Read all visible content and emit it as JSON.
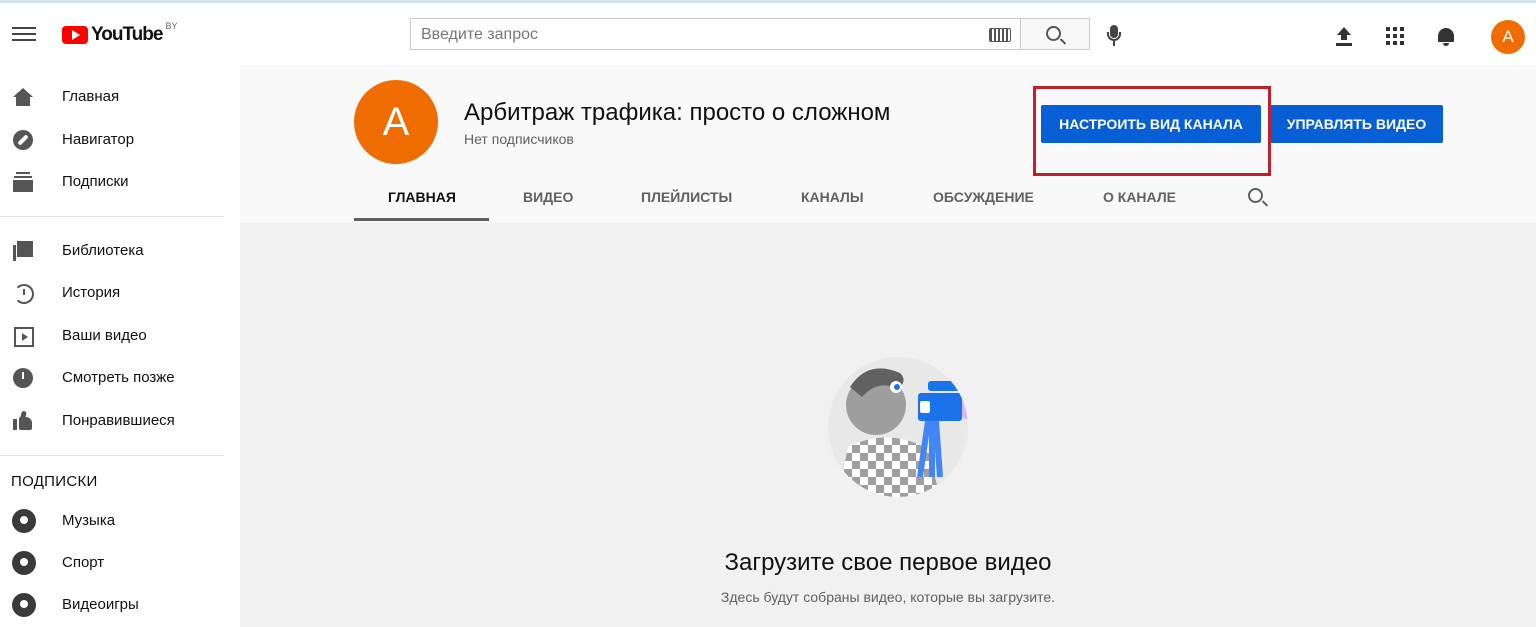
{
  "header": {
    "logo_text": "YouTube",
    "logo_region": "BY",
    "search_placeholder": "Введите запрос",
    "avatar_letter": "А"
  },
  "sidebar": {
    "items": [
      {
        "label": "Главная",
        "icon": "home-icon"
      },
      {
        "label": "Навигатор",
        "icon": "compass-icon"
      },
      {
        "label": "Подписки",
        "icon": "subscriptions-icon"
      },
      {
        "label": "Библиотека",
        "icon": "library-icon"
      },
      {
        "label": "История",
        "icon": "history-icon"
      },
      {
        "label": "Ваши видео",
        "icon": "your-videos-icon"
      },
      {
        "label": "Смотреть позже",
        "icon": "watch-later-icon"
      },
      {
        "label": "Понравившиеся",
        "icon": "liked-icon"
      }
    ],
    "subscriptions_heading": "ПОДПИСКИ",
    "subscriptions": [
      {
        "label": "Музыка",
        "icon": "music-channel-icon"
      },
      {
        "label": "Спорт",
        "icon": "sport-channel-icon"
      },
      {
        "label": "Видеоигры",
        "icon": "gaming-channel-icon"
      }
    ]
  },
  "channel": {
    "avatar_letter": "А",
    "title": "Арбитраж трафика: просто о сложном",
    "subscribers": "Нет подписчиков",
    "customize_button": "НАСТРОИТЬ ВИД КАНАЛА",
    "manage_button": "УПРАВЛЯТЬ ВИДЕО",
    "tabs": [
      "ГЛАВНАЯ",
      "ВИДЕО",
      "ПЛЕЙЛИСТЫ",
      "КАНАЛЫ",
      "ОБСУЖДЕНИЕ",
      "О КАНАЛЕ"
    ],
    "active_tab": "ГЛАВНАЯ"
  },
  "empty_state": {
    "title": "Загрузите свое первое видео",
    "subtitle": "Здесь будут собраны видео, которые вы загрузите."
  },
  "colors": {
    "accent_blue": "#065fd4",
    "avatar_orange": "#ef6c00",
    "highlight_red": "#c0202b",
    "brand_red": "#ff0000"
  }
}
